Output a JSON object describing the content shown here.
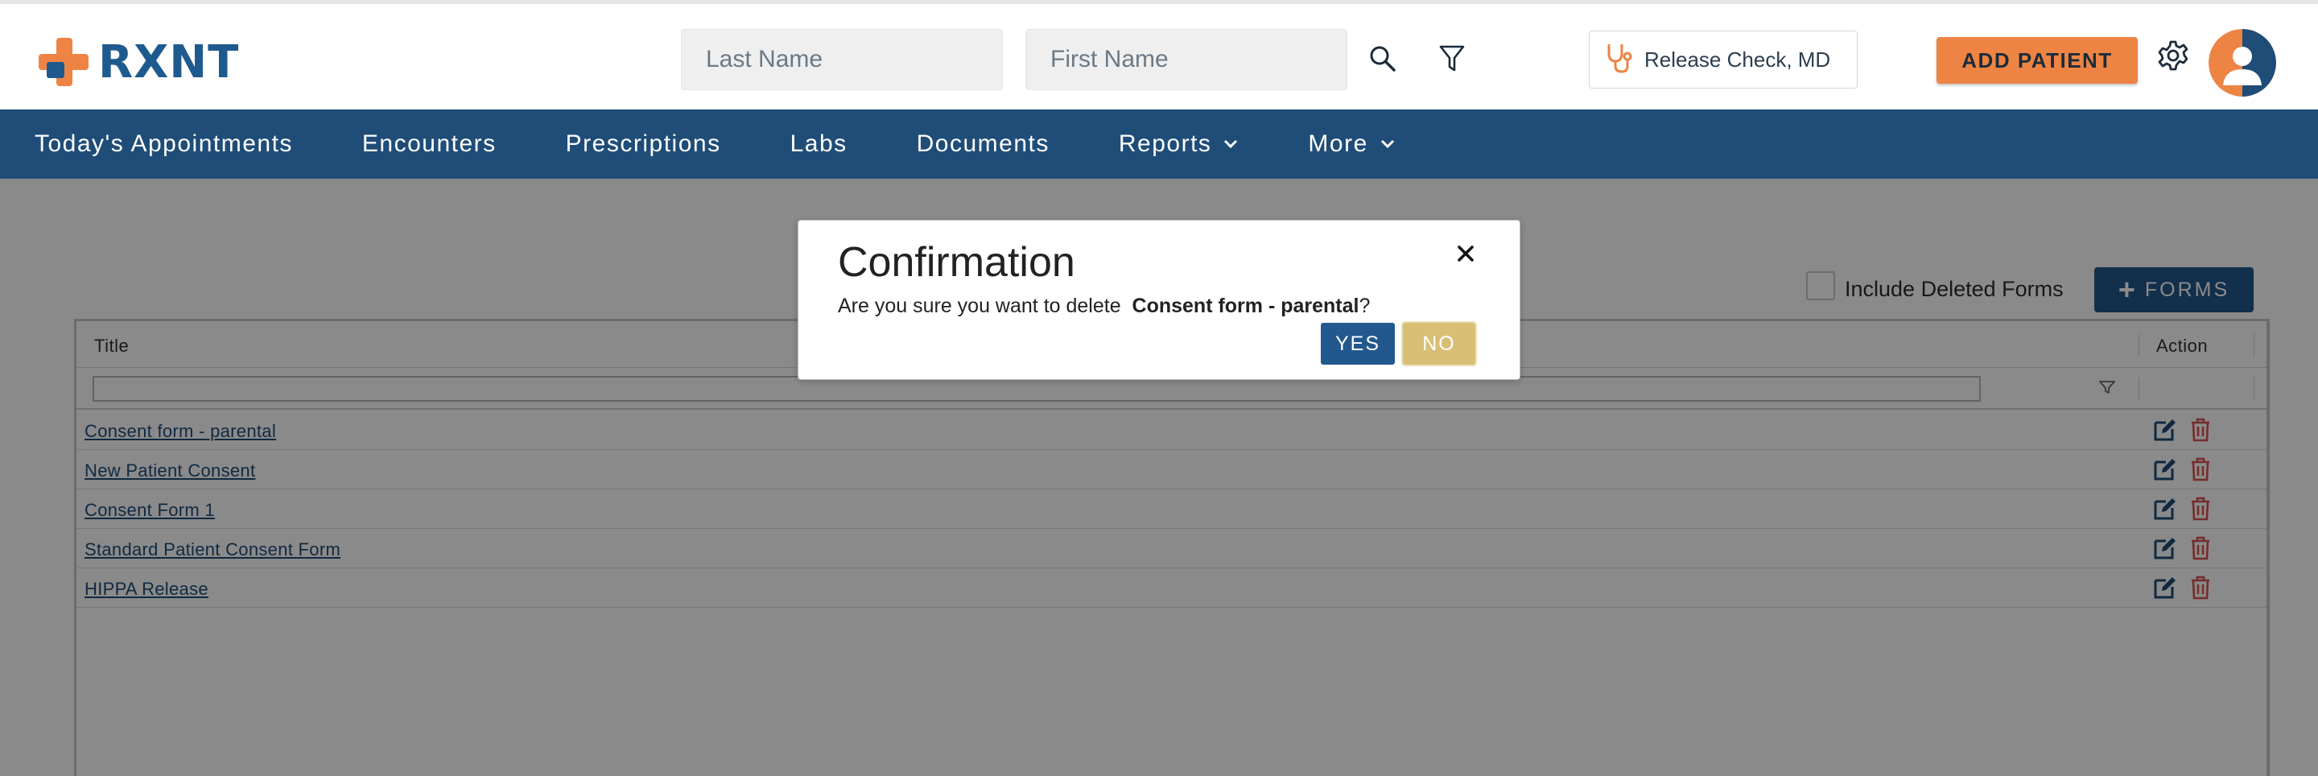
{
  "brand": {
    "logo_text": "RXNT",
    "colors": {
      "primary": "#1f5a8f",
      "accent": "#ee8443",
      "nav_bg": "#1f4d78"
    }
  },
  "header": {
    "last_name_placeholder": "Last Name",
    "first_name_placeholder": "First Name",
    "search_icon": "search-icon",
    "filter_icon": "funnel-icon",
    "provider_icon": "stethoscope-icon",
    "provider_name": "Release Check, MD",
    "add_patient_label": "ADD PATIENT",
    "settings_icon": "gear-icon",
    "avatar_icon": "user-avatar-icon"
  },
  "nav": {
    "items": [
      {
        "label": "Today's Appointments",
        "dropdown": false
      },
      {
        "label": "Encounters",
        "dropdown": false
      },
      {
        "label": "Prescriptions",
        "dropdown": false
      },
      {
        "label": "Labs",
        "dropdown": false
      },
      {
        "label": "Documents",
        "dropdown": false
      },
      {
        "label": "Reports",
        "dropdown": true
      },
      {
        "label": "More",
        "dropdown": true
      }
    ]
  },
  "forms_page": {
    "include_deleted_label": "Include Deleted Forms",
    "include_deleted_checked": false,
    "forms_button_label": "FORMS",
    "table": {
      "columns": {
        "title": "Title",
        "action": "Action"
      },
      "filter_value": "",
      "rows": [
        {
          "title": "Consent form - parental"
        },
        {
          "title": "New Patient Consent"
        },
        {
          "title": "Consent Form 1"
        },
        {
          "title": "Standard Patient Consent Form"
        },
        {
          "title": "HIPPA Release"
        }
      ]
    }
  },
  "modal": {
    "title": "Confirmation",
    "message_prefix": "Are you sure you want to delete",
    "target_name": "Consent form - parental",
    "message_suffix": "?",
    "yes_label": "YES",
    "no_label": "NO",
    "close_icon": "close-icon"
  }
}
